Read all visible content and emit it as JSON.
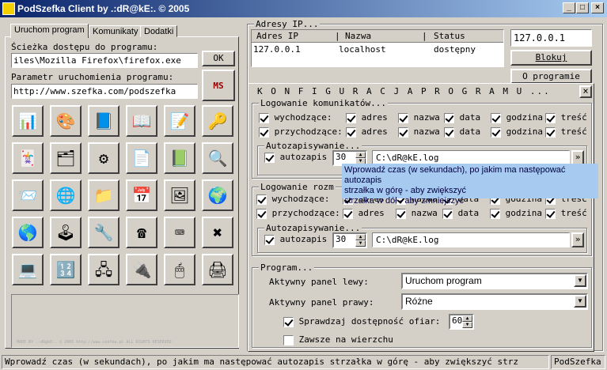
{
  "window": {
    "title": "PodSzefka Client by .:dR@kE:. © 2005"
  },
  "tabs": [
    "Uruchom program",
    "Komunikaty",
    "Dodatki"
  ],
  "left": {
    "path_label": "Ścieżka dostępu do programu:",
    "path_value": "iles\\Mozilla Firefox\\firefox.exe",
    "ok_label": "OK",
    "param_label": "Parametr uruchomienia programu:",
    "param_value": "http://www.szefka.com/podszefka",
    "icons": [
      "📊",
      "🎨",
      "📘",
      "📖",
      "📝",
      "🔑",
      "🃏",
      "🗂",
      "⚙",
      "📄",
      "📗",
      "🔍",
      "📨",
      "🌐",
      "📁",
      "📅",
      "🖼",
      "🌍",
      "🌎",
      "🕹",
      "🔧",
      "☎",
      "⌨",
      "✖",
      "💻",
      "🔢",
      "🖧",
      "🔌",
      "🖱",
      "🖨"
    ],
    "watermark": "MADE BY .:dR@kE:. © 2005 http://www.szefka.pl ALL RIGHTS RESERVED"
  },
  "ip": {
    "group_label": "Adresy IP...",
    "columns": [
      "Adres IP",
      "Nazwa",
      "Status"
    ],
    "rows": [
      {
        "ip": "127.0.0.1",
        "name": "localhost",
        "status": "dostępny"
      }
    ],
    "ip_value": "127.0.0.1",
    "block_label": "Blokuj",
    "about_label": "O programie"
  },
  "config": {
    "title": "K O N F I G U R A C J A   P R O G R A M U ...",
    "close": "×",
    "log1": {
      "label": "Logowanie komunikatów...",
      "rows": [
        {
          "label": "wychodzące:",
          "fields": [
            "adres",
            "nazwa",
            "data",
            "godzina",
            "treść"
          ]
        },
        {
          "label": "przychodzące:",
          "fields": [
            "adres",
            "nazwa",
            "data",
            "godzina",
            "treść"
          ]
        }
      ],
      "autosave_label": "Autozapisywanie...",
      "autosave_text": "autozapis",
      "autosave_value": "30",
      "autosave_path": "C:\\dR@kE.log"
    },
    "log2": {
      "label": "Logowanie rozm",
      "rows": [
        {
          "label": "wychodzące:",
          "fields": [
            "adres",
            "nazwa",
            "data",
            "godzina",
            "treść"
          ]
        },
        {
          "label": "przychodzące:",
          "fields": [
            "adres",
            "nazwa",
            "data",
            "godzina",
            "treść"
          ]
        }
      ],
      "autosave_label": "Autozapisywanie...",
      "autosave_text": "autozapis",
      "autosave_value": "30",
      "autosave_path": "C:\\dR@kE.log"
    },
    "tooltip": [
      "Wprowadź czas (w sekundach), po jakim ma następować autozapis",
      "strzałka w górę - aby zwiększyć",
      "strzałka w dół  - aby zmniejszyć"
    ],
    "program": {
      "label": "Program...",
      "left_panel_label": "Aktywny panel lewy:",
      "left_panel_value": "Uruchom program",
      "right_panel_label": "Aktywny panel prawy:",
      "right_panel_value": "Różne",
      "check_label": "Sprawdzaj dostępność ofiar:",
      "check_value": "60",
      "ontop_label": "Zawsze na wierzchu"
    },
    "browse": "»"
  },
  "status": {
    "text": "Wprowadź czas (w sekundach), po jakim ma następować autozapis strzałka w górę - aby zwiększyć strz",
    "app": "PodSzefka"
  }
}
